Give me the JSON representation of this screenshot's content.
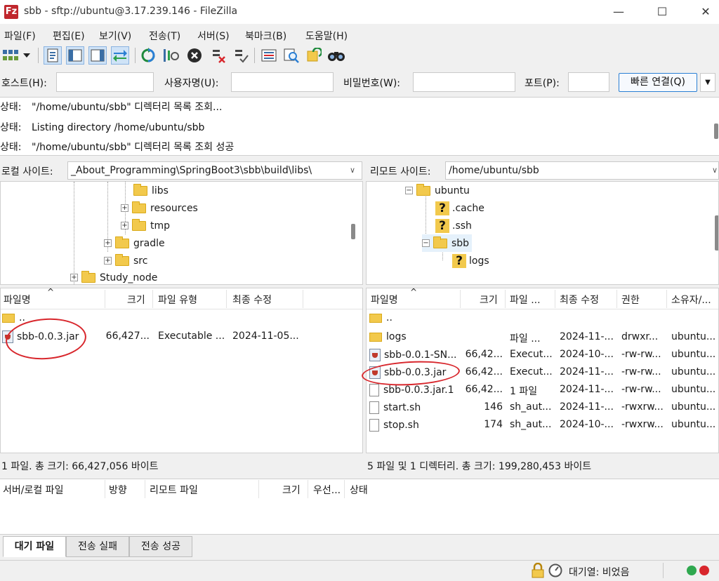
{
  "window": {
    "logo_text": "Fz",
    "title": "sbb - sftp://ubuntu@3.17.239.146 - FileZilla",
    "minimize_glyph": "—",
    "maximize_glyph": "☐",
    "close_glyph": "✕"
  },
  "menu": [
    "파일(F)",
    "편집(E)",
    "보기(V)",
    "전송(T)",
    "서버(S)",
    "북마크(B)",
    "도움말(H)"
  ],
  "quickconnect": {
    "host_label": "호스트(H):",
    "host_value": "",
    "user_label": "사용자명(U):",
    "user_value": "",
    "pass_label": "비밀번호(W):",
    "pass_value": "",
    "port_label": "포트(P):",
    "port_value": "",
    "connect_button": "빠른 연결(Q)",
    "dropdown_glyph": "▼"
  },
  "message_log": [
    {
      "label": "상태:",
      "text": "\"/home/ubuntu/sbb\" 디렉터리 목록 조회..."
    },
    {
      "label": "상태:",
      "text": "Listing directory /home/ubuntu/sbb"
    },
    {
      "label": "상태:",
      "text": "\"/home/ubuntu/sbb\" 디렉터리 목록 조회 성공"
    }
  ],
  "local": {
    "site_label": "로컬 사이트:",
    "path": "_About_Programming\\SpringBoot3\\sbb\\build\\libs\\",
    "tree": [
      {
        "name": "libs",
        "expander": ""
      },
      {
        "name": "resources",
        "expander": "+"
      },
      {
        "name": "tmp",
        "expander": "+"
      },
      {
        "name": "gradle",
        "expander": "+"
      },
      {
        "name": "src",
        "expander": "+"
      },
      {
        "name": "Study_node",
        "expander": "+"
      }
    ],
    "columns": [
      "파일명",
      "크기",
      "파일 유형",
      "최종 수정"
    ],
    "files": [
      {
        "name": "..",
        "size": "",
        "type": "",
        "modified": ""
      },
      {
        "name": "sbb-0.0.3.jar",
        "size": "66,427...",
        "type": "Executable ...",
        "modified": "2024-11-05..."
      }
    ],
    "status": "1 파일. 총 크기: 66,427,056 바이트"
  },
  "remote": {
    "site_label": "리모트 사이트:",
    "path": "/home/ubuntu/sbb",
    "tree": [
      {
        "name": "ubuntu",
        "kind": "folder",
        "expander": "−"
      },
      {
        "name": ".cache",
        "kind": "unknown",
        "expander": ""
      },
      {
        "name": ".ssh",
        "kind": "unknown",
        "expander": ""
      },
      {
        "name": "sbb",
        "kind": "folder",
        "expander": "−"
      },
      {
        "name": "logs",
        "kind": "unknown",
        "expander": ""
      }
    ],
    "columns": [
      "파일명",
      "크기",
      "파일 ...",
      "최종 수정",
      "권한",
      "소유자/..."
    ],
    "files": [
      {
        "name": "..",
        "kind": "folder",
        "size": "",
        "type": "",
        "modified": "",
        "perm": "",
        "owner": ""
      },
      {
        "name": "logs",
        "kind": "folder",
        "size": "",
        "type": "파일 ...",
        "modified": "2024-11-...",
        "perm": "drwxr...",
        "owner": "ubuntu..."
      },
      {
        "name": "sbb-0.0.1-SN...",
        "kind": "jar",
        "size": "66,42...",
        "type": "Execut...",
        "modified": "2024-10-...",
        "perm": "-rw-rw...",
        "owner": "ubuntu..."
      },
      {
        "name": "sbb-0.0.3.jar",
        "kind": "jar",
        "size": "66,42...",
        "type": "Execut...",
        "modified": "2024-11-...",
        "perm": "-rw-rw...",
        "owner": "ubuntu..."
      },
      {
        "name": "sbb-0.0.3.jar.1",
        "kind": "file",
        "size": "66,42...",
        "type": "1 파일",
        "modified": "2024-11-...",
        "perm": "-rw-rw...",
        "owner": "ubuntu..."
      },
      {
        "name": "start.sh",
        "kind": "file",
        "size": "146",
        "type": "sh_aut...",
        "modified": "2024-11-...",
        "perm": "-rwxrw...",
        "owner": "ubuntu..."
      },
      {
        "name": "stop.sh",
        "kind": "file",
        "size": "174",
        "type": "sh_aut...",
        "modified": "2024-10-...",
        "perm": "-rwxrw...",
        "owner": "ubuntu..."
      }
    ],
    "status": "5 파일 및 1 디렉터리. 총 크기: 199,280,453 바이트"
  },
  "queue": {
    "columns": [
      "서버/로컬 파일",
      "방향",
      "리모트 파일",
      "크기",
      "우선...",
      "상태"
    ]
  },
  "tabs": [
    "대기 파일",
    "전송 실패",
    "전송 성공"
  ],
  "statusbar": {
    "queue_text": "대기열: 비었음"
  },
  "colors": {
    "annotation": "#d8262c",
    "led_green": "#2fa84f",
    "led_red": "#d8262c",
    "folder": "#f2c94c"
  }
}
